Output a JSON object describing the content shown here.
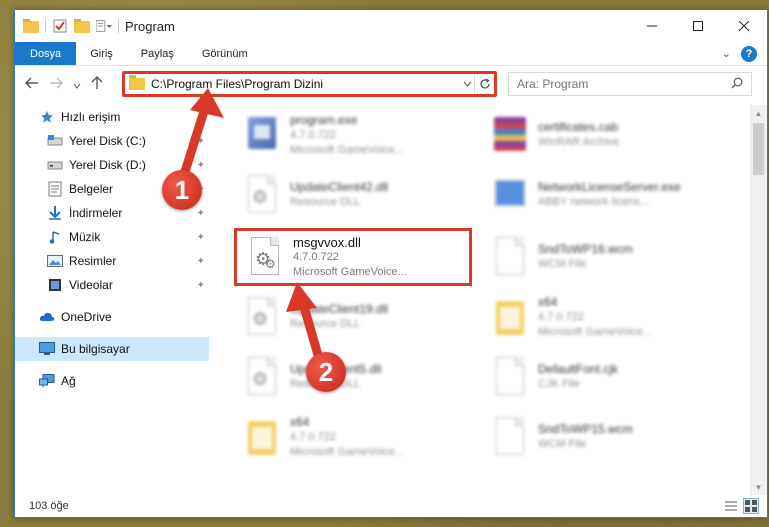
{
  "window": {
    "title": "Program"
  },
  "ribbon": {
    "tabs": [
      "Dosya",
      "Giriş",
      "Paylaş",
      "Görünüm"
    ],
    "expand_glyph": "⌄",
    "help_glyph": "?"
  },
  "address": {
    "path": "C:\\Program Files\\Program Dizini"
  },
  "search": {
    "placeholder": "Ara: Program"
  },
  "sidebar": {
    "items": [
      {
        "label": "Hızlı erişim",
        "icon": "star-icon"
      },
      {
        "label": "Yerel Disk (C:)",
        "icon": "drive-icon",
        "pinned": true
      },
      {
        "label": "Yerel Disk (D:)",
        "icon": "drive-icon",
        "pinned": true
      },
      {
        "label": "Belgeler",
        "icon": "documents-icon",
        "pinned": true
      },
      {
        "label": "İndirmeler",
        "icon": "download-icon",
        "pinned": true
      },
      {
        "label": "Müzik",
        "icon": "music-icon",
        "pinned": true
      },
      {
        "label": "Resimler",
        "icon": "pictures-icon",
        "pinned": true
      },
      {
        "label": "Videolar",
        "icon": "videos-icon",
        "pinned": true
      },
      {
        "label": "OneDrive",
        "icon": "cloud-icon"
      },
      {
        "label": "Bu bilgisayar",
        "icon": "computer-icon",
        "selected": true
      },
      {
        "label": "Ağ",
        "icon": "network-icon"
      }
    ]
  },
  "files": [
    {
      "name": "program.exe",
      "line2": "4.7.0.722",
      "line3": "Microsoft GameVoice...",
      "icon": "exe-icon"
    },
    {
      "name": "certificates.cab",
      "line2": "WinRAR Archive",
      "line3": "",
      "icon": "archive-icon"
    },
    {
      "name": "UpdateClient42.dll",
      "line2": "Resource DLL",
      "line3": "",
      "icon": "dll-icon"
    },
    {
      "name": "NetworkLicenseServer.exe",
      "line2": "ABBY network licens...",
      "line3": "",
      "icon": "app-icon"
    },
    {
      "name": "msgvvox.dll",
      "line2": "4.7.0.722",
      "line3": "Microsoft GameVoice...",
      "icon": "dll-icon"
    },
    {
      "name": "SndToWP16.wcm",
      "line2": "WCM File",
      "line3": "",
      "icon": "file-icon"
    },
    {
      "name": "UpdateClient19.dll",
      "line2": "Resource DLL",
      "line3": "",
      "icon": "dll-icon"
    },
    {
      "name": "x64",
      "line2": "4.7.0.722",
      "line3": "Microsoft GameVoice...",
      "icon": "folder-file-icon"
    },
    {
      "name": "UpdateClient5.dll",
      "line2": "Resource DLL",
      "line3": "",
      "icon": "dll-icon"
    },
    {
      "name": "DefaultFont.cjk",
      "line2": "CJK File",
      "line3": "",
      "icon": "file-icon"
    },
    {
      "name": "x64",
      "line2": "4.7.0.722",
      "line3": "Microsoft GameVoice...",
      "icon": "folder-file-icon"
    },
    {
      "name": "SndToWP15.wcm",
      "line2": "WCM File",
      "line3": "",
      "icon": "file-icon"
    }
  ],
  "status": {
    "count": "103 öğe"
  },
  "annotations": {
    "step1": "1",
    "step2": "2",
    "color": "#d9382b"
  }
}
